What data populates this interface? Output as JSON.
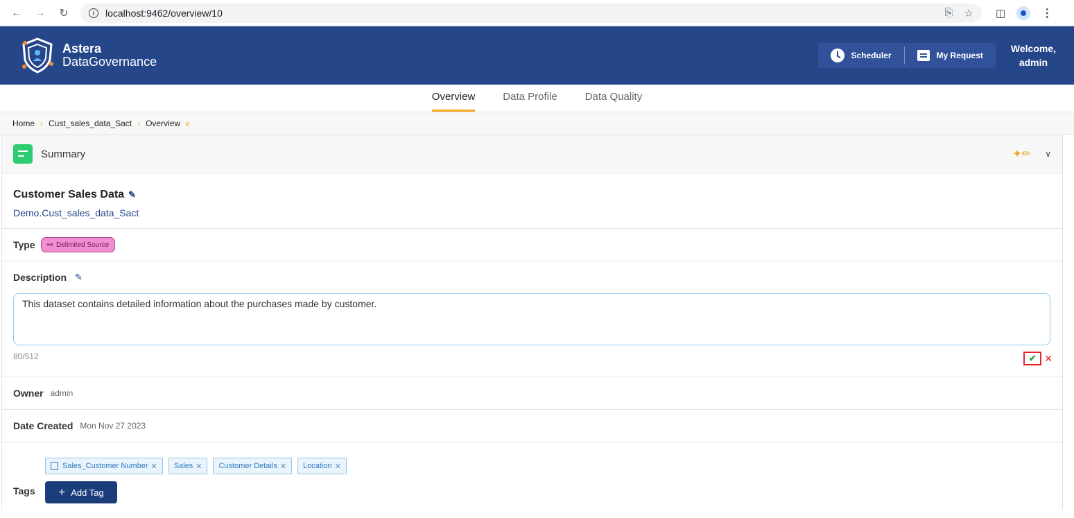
{
  "browser": {
    "url": "localhost:9462/overview/10"
  },
  "header": {
    "brand_line1": "Astera",
    "brand_line2": "DataGovernance",
    "scheduler_label": "Scheduler",
    "my_request_label": "My Request",
    "welcome_line1": "Welcome,",
    "welcome_line2": "admin"
  },
  "tabs": [
    {
      "label": "Overview",
      "active": true
    },
    {
      "label": "Data Profile",
      "active": false
    },
    {
      "label": "Data Quality",
      "active": false
    }
  ],
  "breadcrumb": {
    "home": "Home",
    "dataset": "Cust_sales_data_Sact",
    "current": "Overview"
  },
  "summary": {
    "header_title": "Summary",
    "dataset_title": "Customer Sales Data",
    "dataset_path": "Demo.Cust_sales_data_Sact",
    "type_label": "Type",
    "type_value": "Delimited Source",
    "description_label": "Description",
    "description_value": "This dataset contains detailed information about the purchases made by customer.",
    "description_count": "80/512",
    "owner_label": "Owner",
    "owner_value": "admin",
    "date_label": "Date Created",
    "date_value": "Mon Nov 27 2023",
    "tags_label": "Tags",
    "tags": [
      {
        "label": "Sales_Customer Number",
        "has_icon": true
      },
      {
        "label": "Sales",
        "has_icon": false
      },
      {
        "label": "Customer Details",
        "has_icon": false
      },
      {
        "label": "Location",
        "has_icon": false
      }
    ],
    "add_tag_label": "Add Tag"
  },
  "colors": {
    "header_bg": "#26468a",
    "accent": "#f5a623",
    "type_badge": "#f18fcf",
    "confirm": "#2e9e3e",
    "cancel": "#e3242b"
  }
}
